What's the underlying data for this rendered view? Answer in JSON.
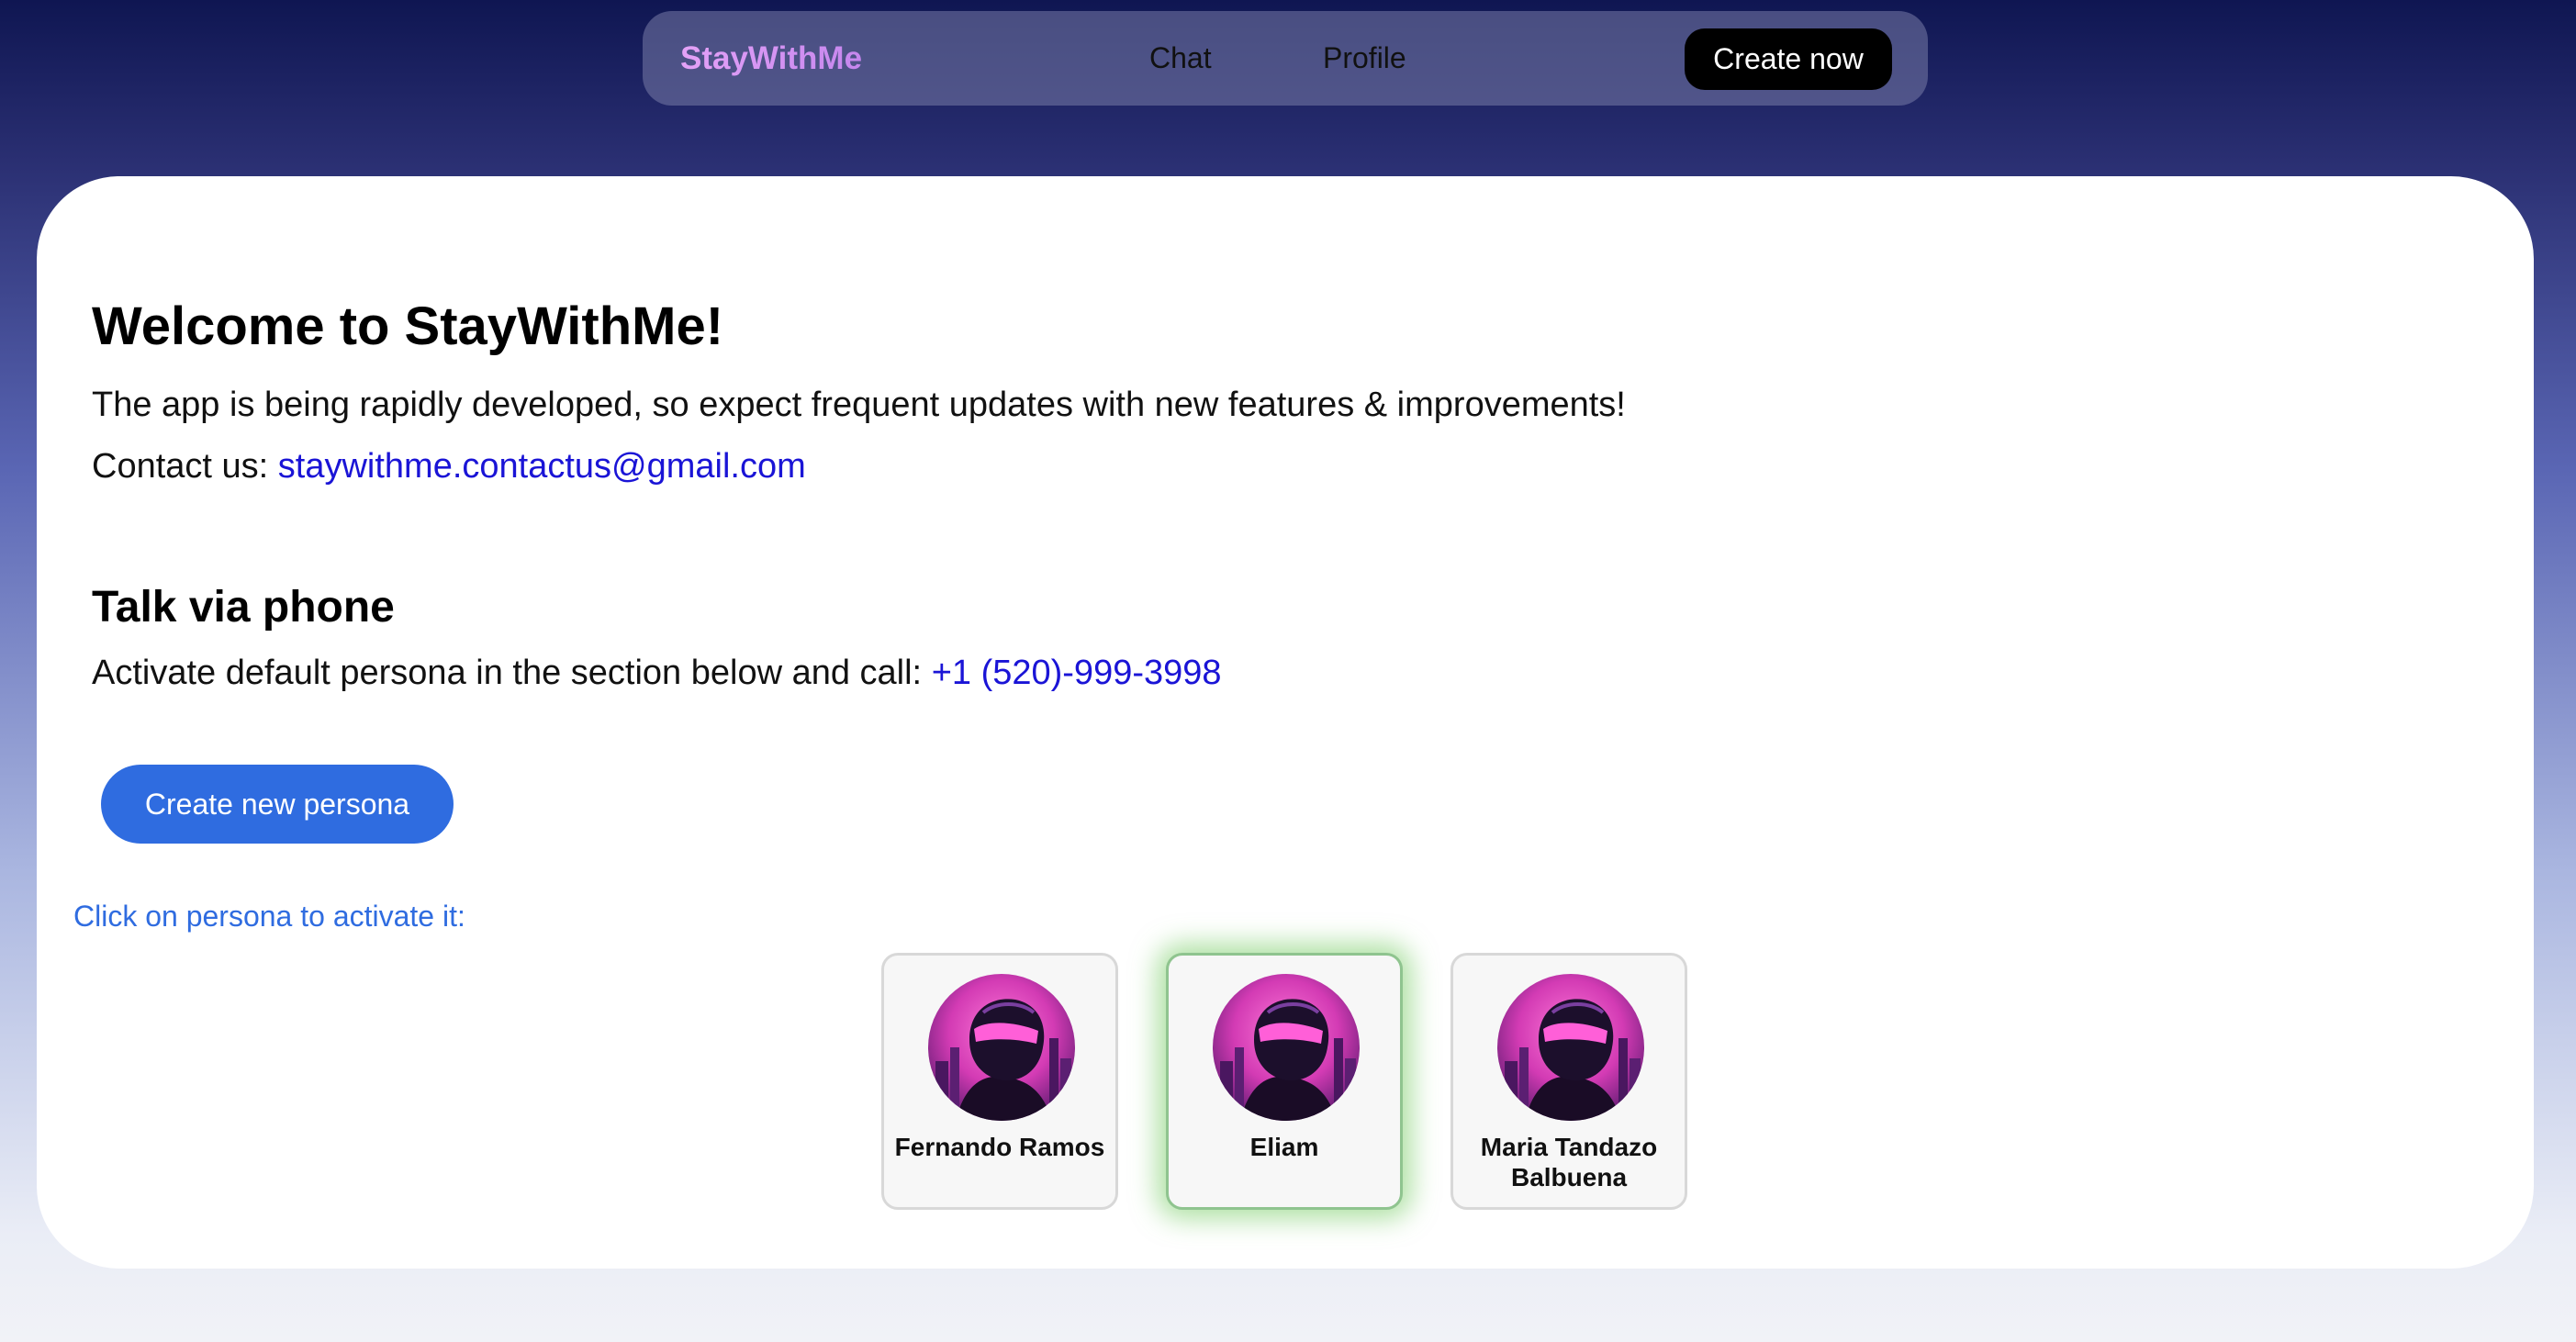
{
  "nav": {
    "brand": "StayWithMe",
    "links": [
      "Chat",
      "Profile"
    ],
    "cta_label": "Create now"
  },
  "main": {
    "title": "Welcome to StayWithMe!",
    "intro": "The app is being rapidly developed, so expect frequent updates with new features & improvements!",
    "contact_label": "Contact us:",
    "contact_email": "staywithme.contactus@gmail.com",
    "phone_section": {
      "title": "Talk via phone",
      "text": "Activate default persona in the section below and call:",
      "phone": "+1 (520)-999-3998"
    },
    "create_persona_label": "Create new persona",
    "activate_hint": "Click on persona to activate it:",
    "personas": [
      {
        "name": "Fernando Ramos",
        "active": false
      },
      {
        "name": "Eliam",
        "active": true
      },
      {
        "name": "Maria Tandazo Balbuena",
        "active": false
      }
    ]
  },
  "colors": {
    "link": "#1a14d6",
    "primary_button": "#2f6ce0",
    "brand_gradient_start": "#e4a2f7",
    "active_glow": "#6ec85a"
  },
  "icons": {
    "avatar": "cyberpunk-helmet-avatar-icon"
  }
}
